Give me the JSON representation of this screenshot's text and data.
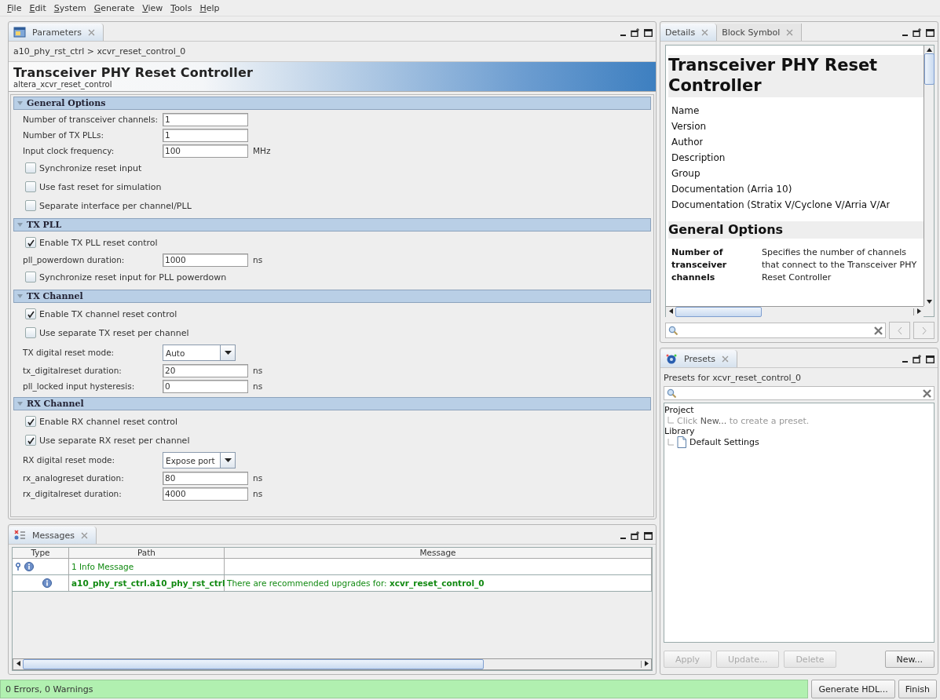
{
  "menu": [
    {
      "label": "File"
    },
    {
      "label": "Edit"
    },
    {
      "label": "System"
    },
    {
      "label": "Generate"
    },
    {
      "label": "View"
    },
    {
      "label": "Tools"
    },
    {
      "label": "Help"
    }
  ],
  "parameters_panel": {
    "tabs": [
      {
        "label": "Parameters",
        "selected": true
      }
    ],
    "breadcrumb": "a10_phy_rst_ctrl > xcvr_reset_control_0",
    "title": "Transceiver PHY Reset Controller",
    "subtitle": "altera_xcvr_reset_control",
    "sections": [
      {
        "title": "General Options",
        "expanded": true,
        "rows": [
          {
            "kind": "field",
            "label": "Number of transceiver channels:",
            "value": "1"
          },
          {
            "kind": "field",
            "label": "Number of TX PLLs:",
            "value": "1"
          },
          {
            "kind": "field",
            "label": "Input clock frequency:",
            "value": "100",
            "unit": "MHz"
          },
          {
            "kind": "checkbox",
            "label": "Synchronize reset input",
            "checked": false
          },
          {
            "kind": "checkbox",
            "label": "Use fast reset for simulation",
            "checked": false
          },
          {
            "kind": "checkbox",
            "label": "Separate interface per channel/PLL",
            "checked": false
          }
        ]
      },
      {
        "title": "TX PLL",
        "expanded": true,
        "rows": [
          {
            "kind": "checkbox",
            "label": "Enable TX PLL reset control",
            "checked": true
          },
          {
            "kind": "field",
            "label": "pll_powerdown duration:",
            "value": "1000",
            "unit": "ns"
          },
          {
            "kind": "checkbox",
            "label": "Synchronize reset input for PLL powerdown",
            "checked": false
          }
        ]
      },
      {
        "title": "TX Channel",
        "expanded": true,
        "rows": [
          {
            "kind": "checkbox",
            "label": "Enable TX channel reset control",
            "checked": true
          },
          {
            "kind": "checkbox",
            "label": "Use separate TX reset per channel",
            "checked": false
          },
          {
            "kind": "dropdown",
            "label": "TX digital reset mode:",
            "value": "Auto"
          },
          {
            "kind": "field",
            "label": "tx_digitalreset duration:",
            "value": "20",
            "unit": "ns"
          },
          {
            "kind": "field",
            "label": "pll_locked input hysteresis:",
            "value": "0",
            "unit": "ns"
          }
        ]
      },
      {
        "title": "RX Channel",
        "expanded": true,
        "rows": [
          {
            "kind": "checkbox",
            "label": "Enable RX channel reset control",
            "checked": true
          },
          {
            "kind": "checkbox",
            "label": "Use separate RX reset per channel",
            "checked": true
          },
          {
            "kind": "dropdown",
            "label": "RX digital reset mode:",
            "value": "Expose port"
          },
          {
            "kind": "field",
            "label": "rx_analogreset duration:",
            "value": "80",
            "unit": "ns"
          },
          {
            "kind": "field",
            "label": "rx_digitalreset duration:",
            "value": "4000",
            "unit": "ns"
          }
        ]
      }
    ]
  },
  "messages_panel": {
    "tabs": [
      {
        "label": "Messages",
        "selected": true
      }
    ],
    "columns": [
      "Type",
      "Path",
      "Message"
    ],
    "rows": [
      {
        "kind": "summary",
        "path": "1 Info Message"
      },
      {
        "kind": "detail",
        "path": "a10_phy_rst_ctrl.a10_phy_rst_ctrl",
        "message": "There are recommended upgrades for: **xcvr_reset_control_0**"
      }
    ]
  },
  "details_panel": {
    "tabs": [
      {
        "label": "Details",
        "selected": true
      },
      {
        "label": "Block Symbol",
        "selected": false
      }
    ],
    "title": "Transceiver PHY Reset Controller",
    "fields": [
      "Name",
      "Version",
      "Author",
      "Description",
      "Group",
      "Documentation (Arria 10)",
      "Documentation (Stratix V/Cyclone V/Arria V/Ar"
    ],
    "section": "General Options",
    "params": [
      {
        "name": "Number of transceiver channels",
        "description": "Specifies the number of channels that connect to the Transceiver PHY Reset Controller"
      }
    ]
  },
  "presets_panel": {
    "tabs": [
      {
        "label": "Presets",
        "selected": true
      }
    ],
    "heading": "Presets for xcvr_reset_control_0",
    "tree": [
      {
        "label": "Project",
        "children": [
          {
            "kind": "hint",
            "label": "Click **New...** to create a preset."
          }
        ]
      },
      {
        "label": "Library",
        "children": [
          {
            "kind": "preset",
            "label": "Default Settings"
          }
        ]
      }
    ],
    "buttons": [
      {
        "label": "Apply",
        "disabled": true
      },
      {
        "label": "Update...",
        "disabled": true
      },
      {
        "label": "Delete",
        "disabled": true
      },
      {
        "label": "New...",
        "disabled": false
      }
    ]
  },
  "status_bar": {
    "text": "0 Errors, 0 Warnings",
    "buttons": [
      {
        "label": "Generate HDL..."
      },
      {
        "label": "Finish"
      }
    ]
  }
}
